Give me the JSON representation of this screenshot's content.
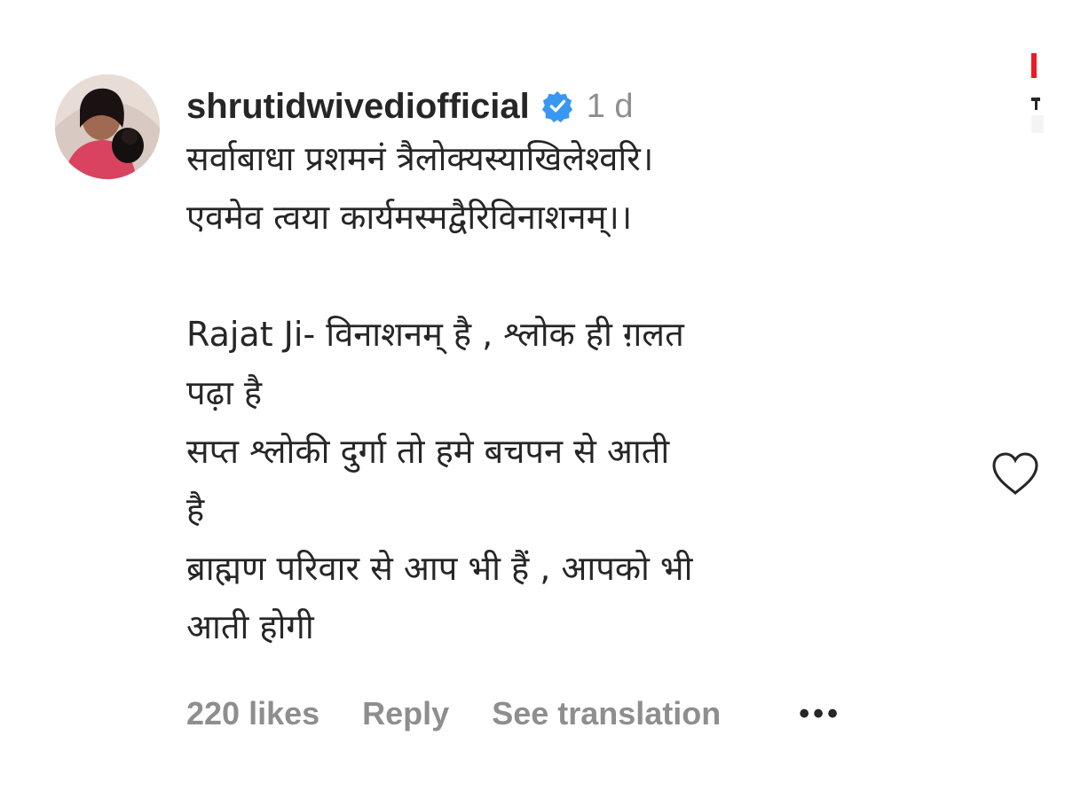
{
  "comment": {
    "username": "shrutidwivediofficial",
    "timestamp": "1 d",
    "lines": [
      "सर्वाबाधा प्रशमनं त्रैलोक्यस्याखिलेश्वरि।",
      "एवमेव त्वया कार्यमस्मद्वैरिविनाशनम्।।",
      "",
      "Rajat Ji- विनाशनम् है , श्लोक ही ग़लत",
      "पढ़ा है",
      "सप्त श्लोकी दुर्गा तो हमे बचपन से आती",
      "है",
      "ब्राह्मण परिवार से आप भी हैं , आपको भी",
      "आती होगी"
    ],
    "likes": "220 likes",
    "reply_label": "Reply",
    "translation_label": "See translation",
    "more_label": "•••"
  },
  "icons": {
    "verified": "verified-badge-icon",
    "like": "heart-outline-icon",
    "more": "more-options-icon"
  },
  "colors": {
    "verified_blue": "#3897f0",
    "text": "#262626",
    "muted": "#8e8e8e",
    "edge_red": "#ed1c24"
  }
}
